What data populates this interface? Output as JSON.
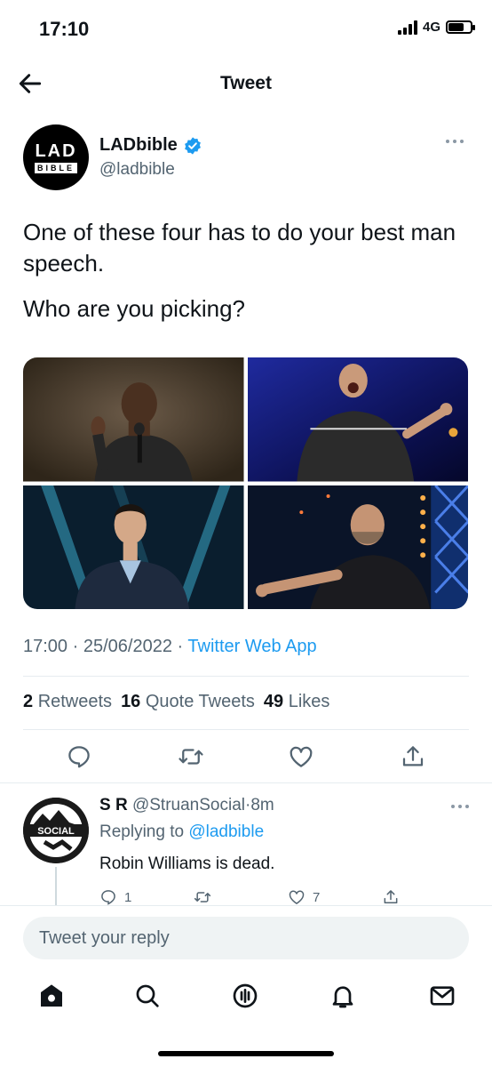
{
  "status_bar": {
    "time": "17:10",
    "network": "4G"
  },
  "header": {
    "title": "Tweet",
    "back_icon": "arrow-left-icon"
  },
  "tweet": {
    "author_name": "LADbible",
    "author_handle": "@ladbible",
    "avatar_text_top": "LAD",
    "avatar_text_bottom": "BIBLE",
    "text_line1": "One of these four has to do your best man speech.",
    "text_line2": "Who are you picking?",
    "time": "17:00",
    "date": "25/06/2022",
    "separator": "·",
    "source": "Twitter Web App",
    "stats": {
      "retweets_count": "2",
      "retweets_label": "Retweets",
      "quotes_count": "16",
      "quotes_label": "Quote Tweets",
      "likes_count": "49",
      "likes_label": "Likes"
    }
  },
  "reply": {
    "name": "S R",
    "handle": "@StruanSocial",
    "time": "8m",
    "replying_prefix": "Replying to",
    "replying_to": "@ladbible",
    "text": "Robin Williams is dead.",
    "reply_count": "1",
    "like_count": "7"
  },
  "compose": {
    "placeholder": "Tweet your reply"
  },
  "colors": {
    "accent": "#1d9bf0",
    "text": "#0f1419",
    "secondary": "#536471"
  }
}
